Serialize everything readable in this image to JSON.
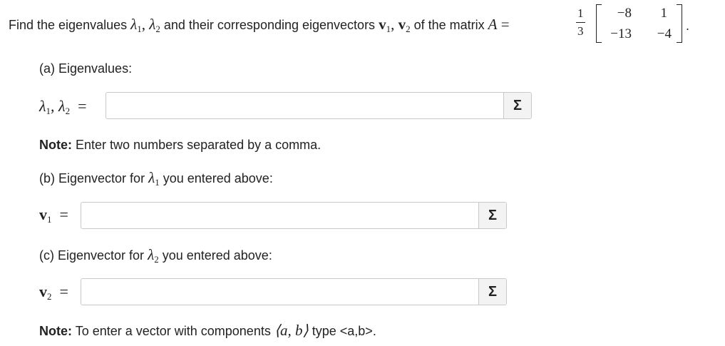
{
  "question": {
    "prefix": "Find the eigenvalues",
    "lambda1": "λ",
    "sub1": "1",
    "comma": ",",
    "lambda2": "λ",
    "sub2": "2",
    "middle": "and their corresponding eigenvectors",
    "v1": "v",
    "v1sub": "1",
    "v2": "v",
    "v2sub": "2",
    "suffix": "of the matrix",
    "matrix_name": "A",
    "equals": "=",
    "frac_num": "1",
    "frac_den": "3",
    "matrix": [
      "−8",
      "1",
      "−13",
      "−4"
    ],
    "period": "."
  },
  "part_a": {
    "label": "(a) Eigenvalues:",
    "lhs_lambda": "λ",
    "lhs_sub1": "1",
    "lhs_comma": ",",
    "lhs_lambda2": "λ",
    "lhs_sub2": "2",
    "lhs_eq": "=",
    "value": "",
    "note_bold": "Note:",
    "note_text": "Enter two numbers separated by a comma."
  },
  "part_b": {
    "label_pre": "(b) Eigenvector for",
    "lambda": "λ",
    "sub": "1",
    "label_post": "you entered above:",
    "lhs_v": "v",
    "lhs_sub": "1",
    "lhs_eq": "=",
    "value": ""
  },
  "part_c": {
    "label_pre": "(c) Eigenvector for",
    "lambda": "λ",
    "sub": "2",
    "label_post": "you entered above:",
    "lhs_v": "v",
    "lhs_sub": "2",
    "lhs_eq": "=",
    "value": ""
  },
  "footer": {
    "note_bold": "Note:",
    "note_text": "To enter a vector with components",
    "vector": "⟨a, b⟩",
    "note_end": "type <a,b>."
  },
  "sigma_symbol": "Σ"
}
